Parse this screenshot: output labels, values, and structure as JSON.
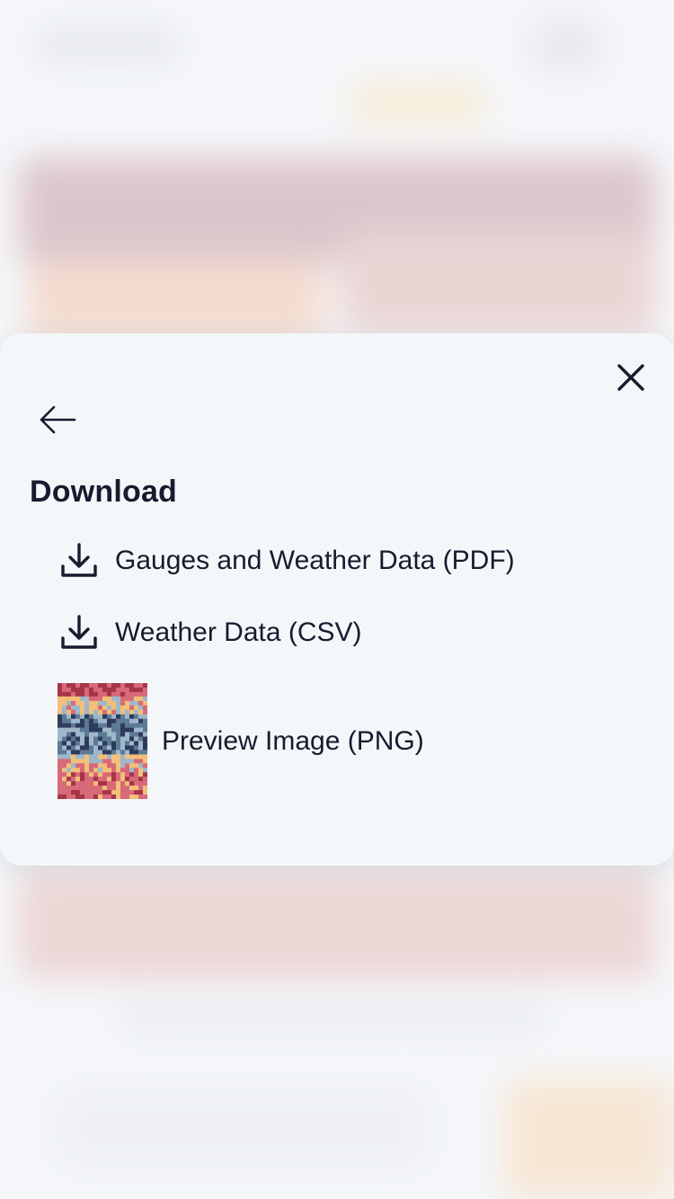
{
  "modal": {
    "title": "Download",
    "options": [
      {
        "label": "Gauges and Weather Data (PDF)",
        "icon": "download-icon"
      },
      {
        "label": "Weather Data (CSV)",
        "icon": "download-icon"
      },
      {
        "label": "Preview Image (PNG)",
        "icon": "preview-thumbnail"
      }
    ],
    "close_icon": "close-icon",
    "back_icon": "arrow-left-icon"
  },
  "colors": {
    "sheet_bg": "#f4f7f9",
    "text": "#161b2e",
    "thumb_palette": [
      "#a8344a",
      "#d86a78",
      "#f2c079",
      "#9fb8c9",
      "#5c7a96",
      "#2d3b5a"
    ]
  }
}
